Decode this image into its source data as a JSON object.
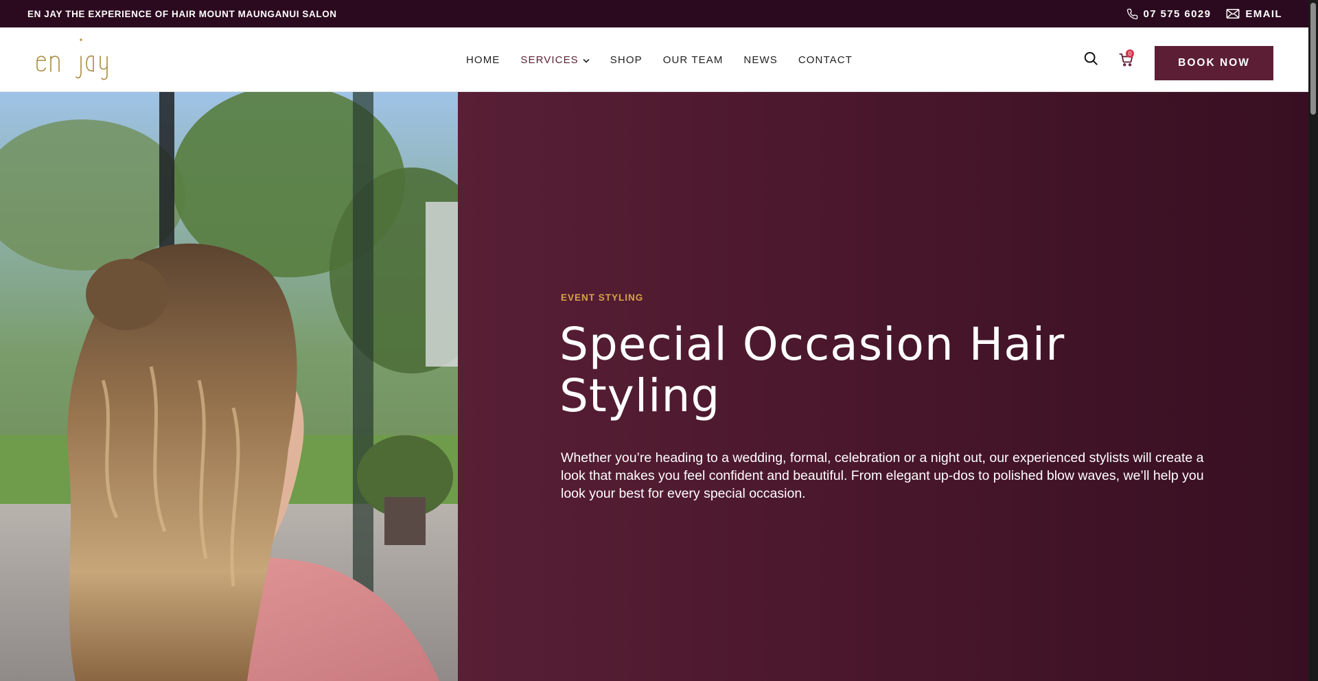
{
  "topbar": {
    "tagline": "EN JAY THE EXPERIENCE OF HAIR MOUNT MAUNGANUI SALON",
    "phone": "07 575 6029",
    "email_label": "EMAIL",
    "phone_icon": "phone-icon",
    "email_icon": "envelope-icon"
  },
  "logo": {
    "text": "en jay",
    "color": "#a88a3a"
  },
  "nav": {
    "items": [
      {
        "label": "HOME"
      },
      {
        "label": "SERVICES",
        "has_dropdown": true,
        "active": true
      },
      {
        "label": "SHOP"
      },
      {
        "label": "OUR TEAM"
      },
      {
        "label": "NEWS"
      },
      {
        "label": "CONTACT"
      }
    ]
  },
  "header": {
    "search_icon": "search-icon",
    "cart_icon": "cart-icon",
    "cart_count": "0",
    "book_label": "BOOK NOW"
  },
  "hero": {
    "eyebrow": "EVENT STYLING",
    "title_line1": "Special Occasion Hair",
    "title_line2": "Styling",
    "description": "Whether you’re heading to a wedding, formal, celebration or a night out, our experienced stylists will create a look that makes you feel confident and beautiful. From elegant up-dos to polished blow waves, we’ll help you look your best for every special occasion."
  },
  "colors": {
    "topbar_bg": "#2b0a1f",
    "accent": "#5b1e35",
    "eyebrow": "#d6a34a",
    "cart_badge": "#d4334a"
  }
}
